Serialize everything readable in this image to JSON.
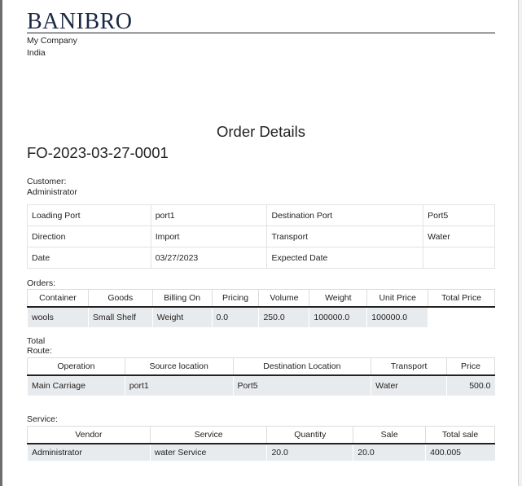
{
  "company": {
    "logo": "BANIBRO",
    "name": "My Company",
    "country": "India"
  },
  "document": {
    "title": "Order Details",
    "reference": "FO-2023-03-27-0001"
  },
  "customer": {
    "label": "Customer:",
    "name": "Administrator"
  },
  "info": [
    [
      "Loading Port",
      "port1",
      "Destination Port",
      "Port5"
    ],
    [
      "Direction",
      "Import",
      "Transport",
      "Water"
    ],
    [
      "Date",
      "03/27/2023",
      "Expected Date",
      ""
    ]
  ],
  "orders": {
    "label": "Orders:",
    "headers": [
      "Container",
      "Goods",
      "Billing On",
      "Pricing",
      "Volume",
      "Weight",
      "Unit Price",
      "Total Price"
    ],
    "rows": [
      [
        "wools",
        "Small Shelf",
        "Weight",
        "0.0",
        "250.0",
        "100000.0",
        "100000.0"
      ]
    ]
  },
  "totals": {
    "total_label": "Total",
    "route_label": "Route:"
  },
  "route": {
    "headers": [
      "Operation",
      "Source location",
      "Destination Location",
      "Transport",
      "Price"
    ],
    "rows": [
      [
        "Main Carriage",
        "port1",
        "Port5",
        "Water",
        "500.0"
      ]
    ]
  },
  "service": {
    "label": "Service:",
    "headers": [
      "Vendor",
      "Service",
      "Quantity",
      "Sale",
      "Total sale"
    ],
    "rows": [
      [
        "Administrator",
        "water Service",
        "20.0",
        "20.0",
        "400.005"
      ]
    ]
  }
}
